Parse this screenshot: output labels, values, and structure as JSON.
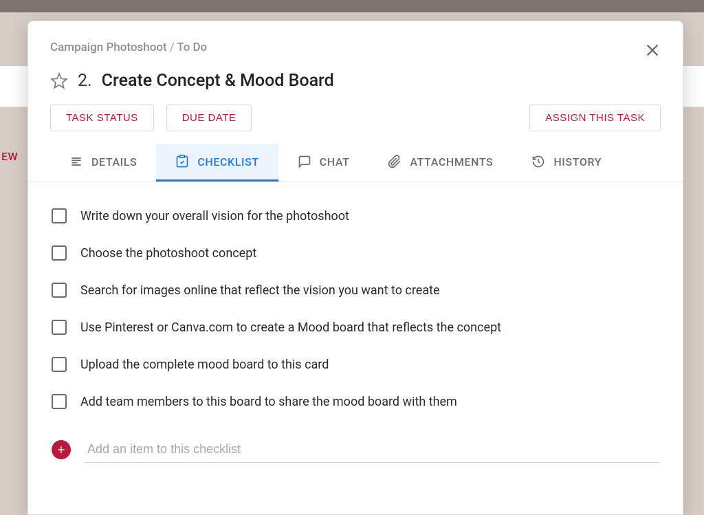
{
  "background": {
    "partial_label": "EW"
  },
  "breadcrumb": {
    "parent": "Campaign Photoshoot",
    "sep": "/",
    "state": "To Do"
  },
  "task": {
    "number": "2.",
    "title": "Create Concept & Mood Board"
  },
  "buttons": {
    "task_status": "TASK STATUS",
    "due_date": "DUE DATE",
    "assign": "ASSIGN THIS TASK"
  },
  "tabs": {
    "details": "DETAILS",
    "checklist": "CHECKLIST",
    "chat": "CHAT",
    "attachments": "ATTACHMENTS",
    "history": "HISTORY"
  },
  "checklist_items": [
    {
      "label": "Write down your overall vision for the photoshoot"
    },
    {
      "label": "Choose the photoshoot concept"
    },
    {
      "label": "Search for images online that reflect the vision you want to create"
    },
    {
      "label": "Use Pinterest or Canva.com to create a Mood board that reflects the concept"
    },
    {
      "label": "Upload the complete mood board to this card"
    },
    {
      "label": "Add team members to this board to share the mood board with them"
    }
  ],
  "add_item": {
    "placeholder": "Add an item to this checklist"
  }
}
